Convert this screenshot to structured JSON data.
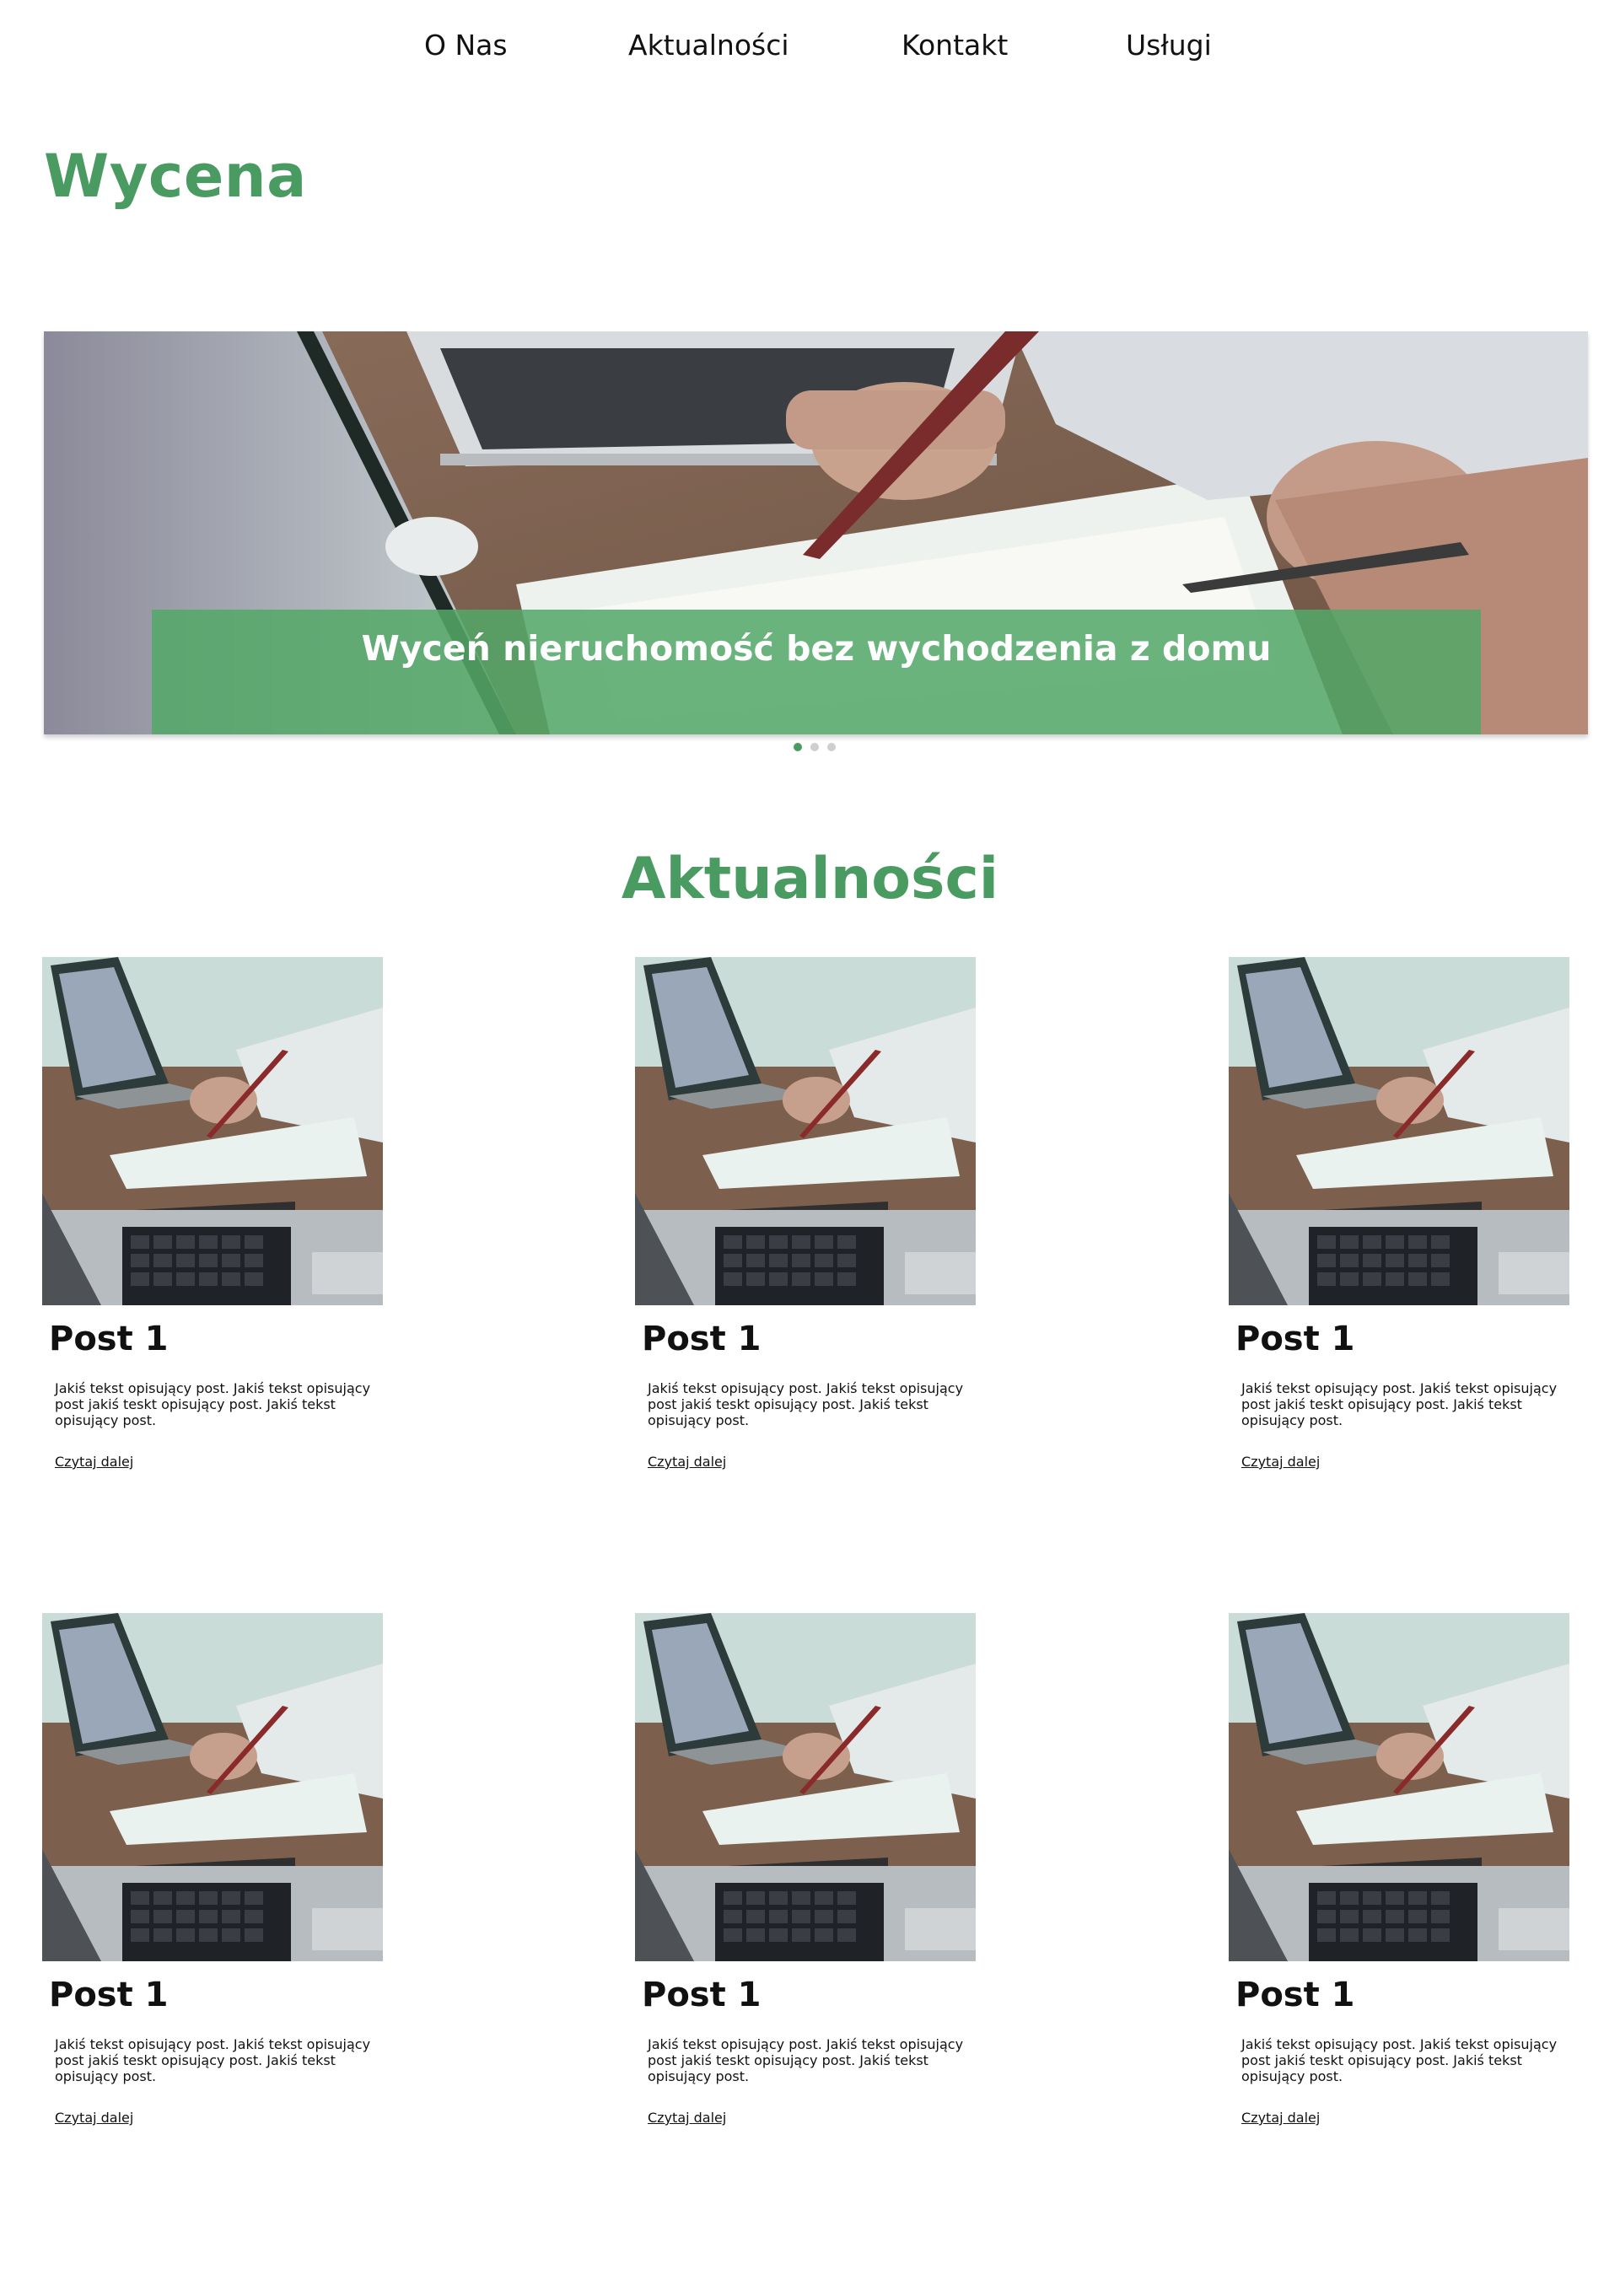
{
  "nav": {
    "items": [
      {
        "label": "O Nas"
      },
      {
        "label": "Aktualności"
      },
      {
        "label": "Kontakt"
      },
      {
        "label": "Usługi"
      }
    ]
  },
  "header": {
    "title": "Wycena"
  },
  "slider": {
    "caption": "Wyceń nieruchomość bez wychodzenia z domu",
    "slide_count": 3,
    "active_slide": 1
  },
  "news": {
    "title": "Aktualności",
    "posts": [
      {
        "title": "Post 1",
        "text": "Jakiś tekst opisujący post. Jakiś tekst opisujący post jakiś teskt opisujący post. Jakiś tekst opisujący post.",
        "link": "Czytaj dalej"
      },
      {
        "title": "Post 1",
        "text": "Jakiś tekst opisujący post. Jakiś tekst opisujący post jakiś teskt opisujący post. Jakiś tekst opisujący post.",
        "link": "Czytaj dalej"
      },
      {
        "title": "Post 1",
        "text": "Jakiś tekst opisujący post. Jakiś tekst opisujący post jakiś teskt opisujący post. Jakiś tekst opisujący post.",
        "link": "Czytaj dalej"
      },
      {
        "title": "Post 1",
        "text": "Jakiś tekst opisujący post. Jakiś tekst opisujący post jakiś teskt opisujący post. Jakiś tekst opisujący post.",
        "link": "Czytaj dalej"
      },
      {
        "title": "Post 1",
        "text": "Jakiś tekst opisujący post. Jakiś tekst opisujący post jakiś teskt opisujący post. Jakiś tekst opisujący post.",
        "link": "Czytaj dalej"
      },
      {
        "title": "Post 1",
        "text": "Jakiś tekst opisujący post. Jakiś tekst opisujący post jakiś teskt opisujący post. Jakiś tekst opisujący post.",
        "link": "Czytaj dalej"
      }
    ]
  },
  "colors": {
    "accent": "#4a9b62",
    "caption_bg": "#54a868"
  }
}
